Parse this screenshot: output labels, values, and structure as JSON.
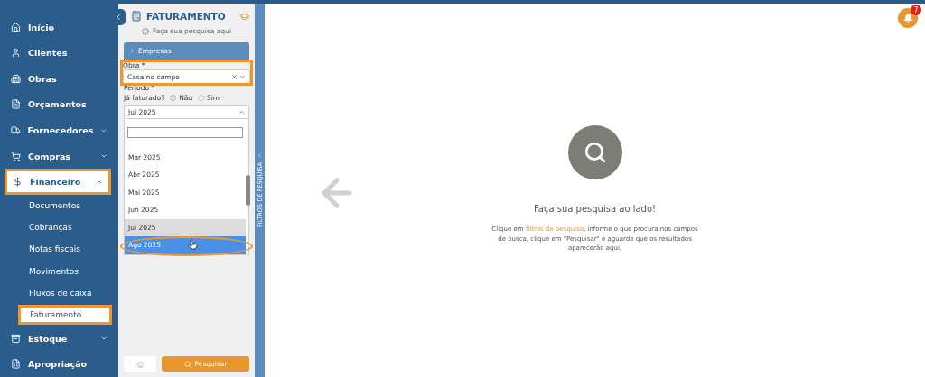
{
  "sidebar": {
    "items": [
      {
        "label": "Início",
        "highlighted": false,
        "has_caret": false
      },
      {
        "label": "Clientes",
        "highlighted": false,
        "has_caret": false
      },
      {
        "label": "Obras",
        "highlighted": false,
        "has_caret": false
      },
      {
        "label": "Orçamentos",
        "highlighted": false,
        "has_caret": false
      },
      {
        "label": "Fornecedores",
        "expanded": false,
        "highlighted": false,
        "has_caret": true
      },
      {
        "label": "Compras",
        "expanded": false,
        "highlighted": false,
        "has_caret": true
      },
      {
        "label": "Financeiro",
        "expanded": true,
        "highlighted": true,
        "has_caret": true,
        "children": [
          {
            "label": "Documentos",
            "selected": false,
            "highlighted": false
          },
          {
            "label": "Cobranças",
            "selected": false,
            "highlighted": false
          },
          {
            "label": "Notas fiscais",
            "selected": false,
            "highlighted": false
          },
          {
            "label": "Movimentos",
            "selected": false,
            "highlighted": false
          },
          {
            "label": "Fluxos de caixa",
            "selected": false,
            "highlighted": false
          },
          {
            "label": "Faturamento",
            "selected": true,
            "highlighted": true
          }
        ]
      },
      {
        "label": "Estoque",
        "expanded": false,
        "highlighted": false,
        "has_caret": true
      },
      {
        "label": "Apropriação",
        "highlighted": false,
        "has_caret": false
      }
    ]
  },
  "filter_panel": {
    "title": "FATURAMENTO",
    "hint": "Faça sua pesquisa aqui",
    "section": "Empresas",
    "section_expanded": false,
    "obra": {
      "label": "Obra *",
      "value": "Casa no campo",
      "highlighted": true
    },
    "periodo_label": "Período *",
    "ja_faturado": {
      "label": "Já faturado?",
      "options": [
        {
          "label": "Não",
          "selected": true
        },
        {
          "label": "Sim",
          "selected": false
        }
      ]
    },
    "periodo": {
      "value": "Jul 2025",
      "open": true,
      "options": [
        {
          "label": "Mar 2025",
          "selected": false,
          "hovered": false,
          "highlighted": false
        },
        {
          "label": "Abr 2025",
          "selected": false,
          "hovered": false,
          "highlighted": false
        },
        {
          "label": "Mai 2025",
          "selected": false,
          "hovered": false,
          "highlighted": false
        },
        {
          "label": "Jun 2025",
          "selected": false,
          "hovered": false,
          "highlighted": false
        },
        {
          "label": "Jul 2025",
          "selected": true,
          "hovered": false,
          "highlighted": false
        },
        {
          "label": "Ago 2025",
          "selected": false,
          "hovered": true,
          "highlighted": true
        }
      ]
    },
    "search_button": "Pesquisar",
    "side_tab": "FILTROS DE PESQUISA"
  },
  "empty_state": {
    "title": "Faça sua pesquisa ao lado!",
    "message": "Clique em **filtros de pesquisa**, informe o que procura nos campos de busca, clique em \"Pesquisar\" e aguarde que os resultados aparecerão aqui."
  },
  "notifications": {
    "count": "7"
  }
}
